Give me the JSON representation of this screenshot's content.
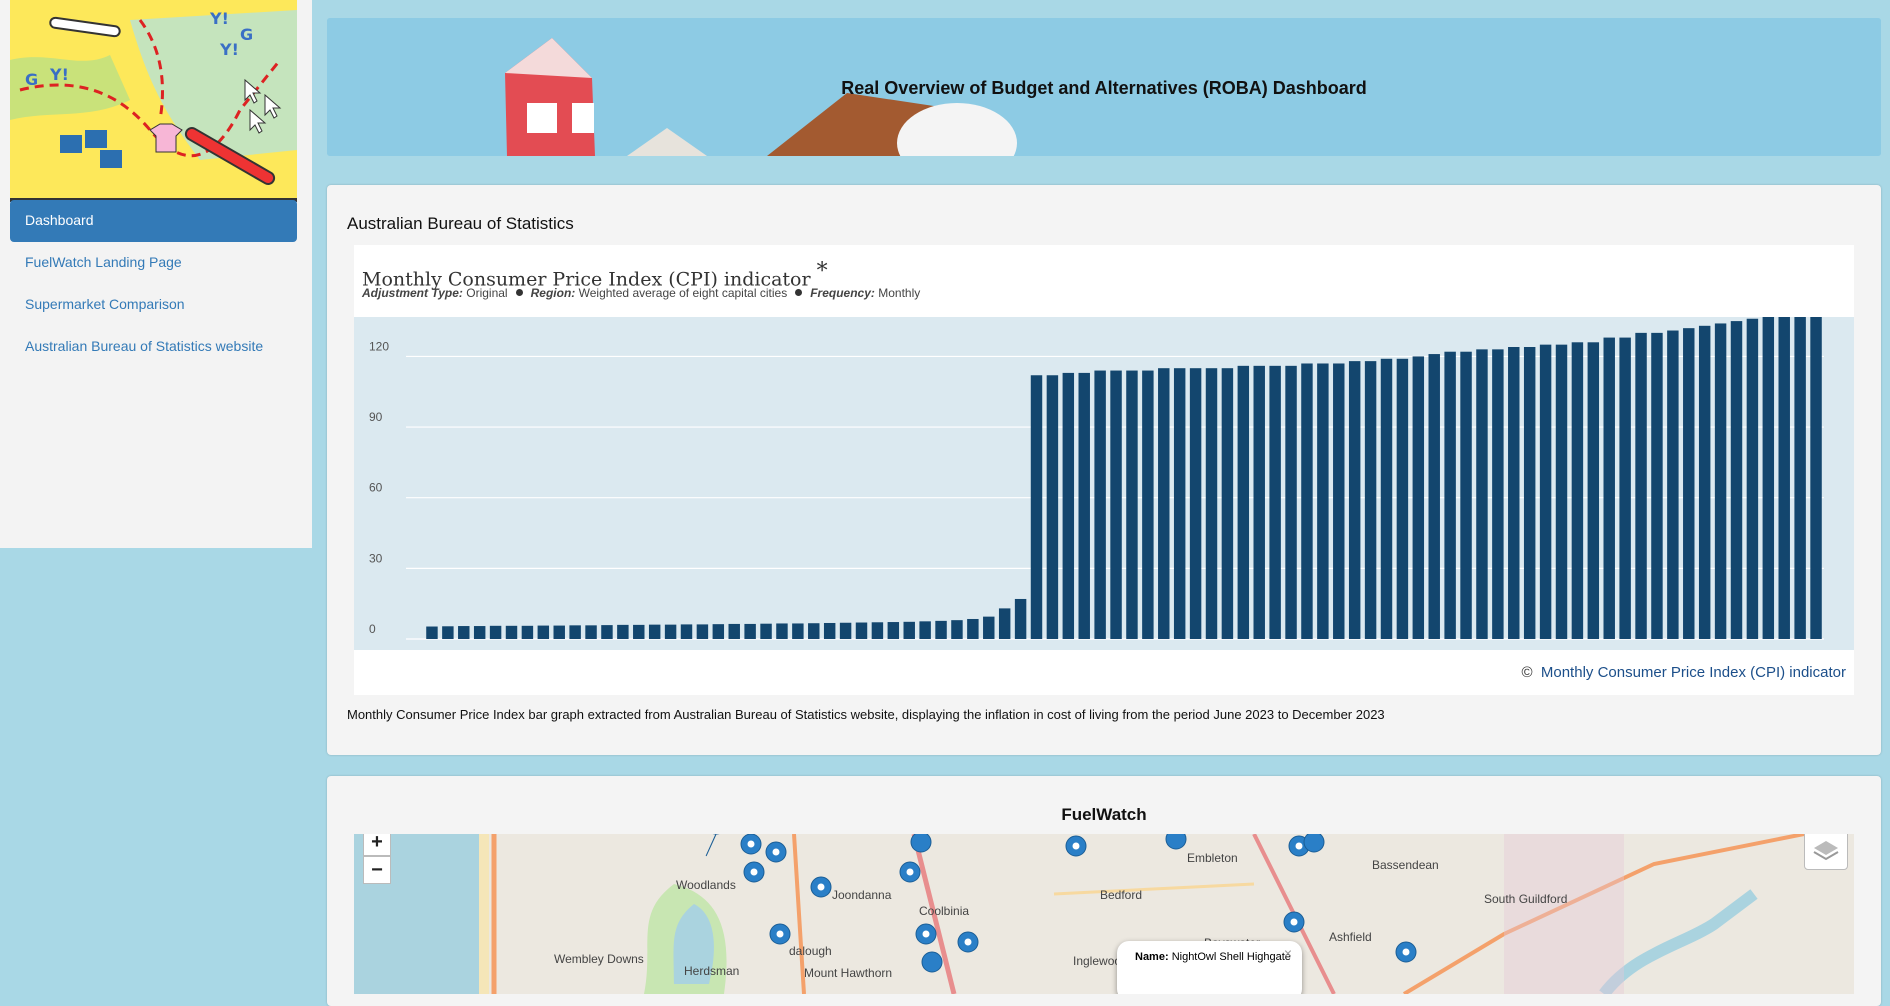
{
  "nav": [
    {
      "label": "Dashboard",
      "active": true
    },
    {
      "label": "FuelWatch Landing Page",
      "active": false
    },
    {
      "label": "Supermarket Comparison",
      "active": false
    },
    {
      "label": "Australian Bureau of Statistics website",
      "active": false
    }
  ],
  "header": {
    "title": "Real Overview of Budget and Alternatives (ROBA) Dashboard"
  },
  "abs": {
    "heading": "Australian Bureau of Statistics",
    "chart_title": "Monthly Consumer Price Index (CPI) indicator",
    "chart_title_mark": "*",
    "meta": {
      "adjustment_label": "Adjustment Type:",
      "adjustment_value": "Original",
      "region_label": "Region:",
      "region_value": "Weighted average of eight capital cities",
      "frequency_label": "Frequency:",
      "frequency_value": "Monthly"
    },
    "footer_symbol": "©",
    "footer_link": "Monthly Consumer Price Index (CPI) indicator",
    "caption": "Monthly Consumer Price Index bar graph extracted from Australian Bureau of Statistics website, displaying the inflation in cost of living from the period June 2023 to December 2023"
  },
  "chart_data": {
    "type": "bar",
    "title": "Monthly Consumer Price Index (CPI) indicator",
    "yticks": [
      0,
      30,
      60,
      90,
      120
    ],
    "ylim": [
      0,
      124
    ],
    "grid": true,
    "bar_color": "#13466e",
    "plot_background": "#dbe9f0",
    "values": [
      5.3,
      5.4,
      5.5,
      5.5,
      5.6,
      5.6,
      5.6,
      5.7,
      5.7,
      5.8,
      5.8,
      5.9,
      6.0,
      6.0,
      6.1,
      6.1,
      6.2,
      6.2,
      6.3,
      6.4,
      6.4,
      6.5,
      6.6,
      6.6,
      6.7,
      6.8,
      6.9,
      7.0,
      7.1,
      7.2,
      7.3,
      7.5,
      7.7,
      8.0,
      8.5,
      9.5,
      13.0,
      17.0,
      112,
      112,
      113,
      113,
      114,
      114,
      114,
      114,
      115,
      115,
      115,
      115,
      115,
      116,
      116,
      116,
      116,
      117,
      117,
      117,
      118,
      118,
      119,
      119,
      120,
      121,
      122,
      122,
      123,
      123,
      124,
      124,
      125,
      125,
      126,
      126,
      128,
      128,
      130,
      130,
      131,
      132,
      133,
      134,
      135,
      136,
      137,
      138,
      139,
      140
    ]
  },
  "fuel": {
    "heading": "FuelWatch",
    "zoom_in": "+",
    "zoom_out": "−",
    "places": [
      "Woodlands",
      "Joondanna",
      "Coolbinia",
      "Bedford",
      "Embleton",
      "Bassendean",
      "South Guildford",
      "Ashfield",
      "Bayswater",
      "Inglewood",
      "Mount Hawthorn",
      "Herdsman",
      "Wembley Downs",
      "dalough"
    ],
    "popup_label": "Name:",
    "popup_value": "NightOwl Shell Highgate",
    "popup_close": "×"
  }
}
